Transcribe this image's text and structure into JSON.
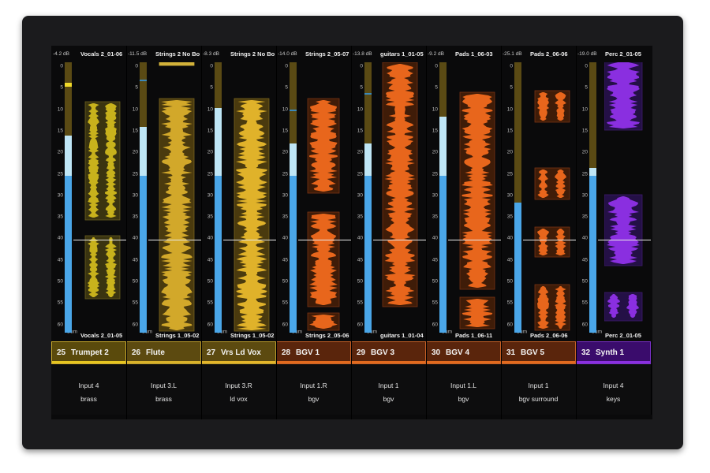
{
  "mixer": {
    "scale_labels": [
      "0",
      "5",
      "10",
      "15",
      "20",
      "25",
      "30",
      "35",
      "40",
      "45",
      "50",
      "55",
      "60",
      "Sum"
    ],
    "channels": [
      {
        "num": "25",
        "name": "Trumpet 2",
        "db": "-4.2 dB",
        "top_clip": "Vocals 2_01-06",
        "bottom_clip": "Vocals 2_01-05",
        "input": "Input 4",
        "group": "brass",
        "color": "#c8b21c",
        "name_bg": "#5a4a0c",
        "name_border": "#c9a92c",
        "bar": "#e6c520",
        "level": 0.58,
        "mid": 0.15,
        "peak": 0.09,
        "tick": null,
        "style": "yellow"
      },
      {
        "num": "26",
        "name": "Flute",
        "db": "-11.5 dB",
        "top_clip": "Strings 2 No Bo",
        "bottom_clip": "Strings 1_05-02",
        "input": "Input 3.L",
        "group": "brass",
        "color": "#d2a82a",
        "name_bg": "#5c4a10",
        "name_border": "#b99a2c",
        "bar": "#d9b22a",
        "level": 0.58,
        "mid": 0.18,
        "peak": null,
        "tick": 0.93,
        "style": "gold"
      },
      {
        "num": "27",
        "name": "Vrs Ld Vox",
        "db": "-8.3 dB",
        "top_clip": "Strings 2 No Bo",
        "bottom_clip": "Strings 1_05-02",
        "input": "Input 3.R",
        "group": "ld vox",
        "color": "#e0b22a",
        "name_bg": "#5c4a10",
        "name_border": "#b99a2c",
        "bar": "#e3b52a",
        "level": 0.58,
        "mid": 0.25,
        "peak": null,
        "tick": null,
        "style": "gold"
      },
      {
        "num": "28",
        "name": "BGV 1",
        "db": "-14.0 dB",
        "top_clip": "Strings 2_05-07",
        "bottom_clip": "Strings 2_05-06",
        "input": "Input 1.R",
        "group": "bgv",
        "color": "#e8661c",
        "name_bg": "#5a250c",
        "name_border": "#c56026",
        "bar": "#e26a1e",
        "level": 0.58,
        "mid": 0.12,
        "peak": null,
        "tick": 0.82,
        "style": "orange"
      },
      {
        "num": "29",
        "name": "BGV 3",
        "db": "-13.8 dB",
        "top_clip": "guitars 1_01-05",
        "bottom_clip": "guitars 1_01-04",
        "input": "Input 1",
        "group": "bgv",
        "color": "#e8661c",
        "name_bg": "#5a250c",
        "name_border": "#c56026",
        "bar": "#e26a1e",
        "level": 0.58,
        "mid": 0.12,
        "peak": null,
        "tick": 0.88,
        "style": "orange"
      },
      {
        "num": "30",
        "name": "BGV 4",
        "db": "-9.2 dB",
        "top_clip": "Pads 1_06-03",
        "bottom_clip": "Pads 1_06-11",
        "input": "Input 1.L",
        "group": "bgv",
        "color": "#e8661c",
        "name_bg": "#5a250c",
        "name_border": "#c56026",
        "bar": "#e26a1e",
        "level": 0.58,
        "mid": 0.22,
        "peak": null,
        "tick": null,
        "style": "orange"
      },
      {
        "num": "31",
        "name": "BGV 5",
        "db": "-25.1 dB",
        "top_clip": "Pads 2_06-06",
        "bottom_clip": "Pads 2_06-06",
        "input": "Input 1",
        "group": "bgv surround",
        "color": "#e8661c",
        "name_bg": "#5a250c",
        "name_border": "#c56026",
        "bar": "#e26a1e",
        "level": 0.48,
        "mid": 0.0,
        "peak": null,
        "tick": null,
        "style": "orange"
      },
      {
        "num": "32",
        "name": "Synth 1",
        "db": "-19.0 dB",
        "top_clip": "Perc 2_01-05",
        "bottom_clip": "Perc 2_01-05",
        "input": "Input 4",
        "group": "keys",
        "color": "#8a2fe0",
        "name_bg": "#3a0c6c",
        "name_border": "#7a30c8",
        "bar": "#8a2fe0",
        "level": 0.58,
        "mid": 0.03,
        "peak": null,
        "tick": null,
        "style": "purple"
      }
    ]
  }
}
